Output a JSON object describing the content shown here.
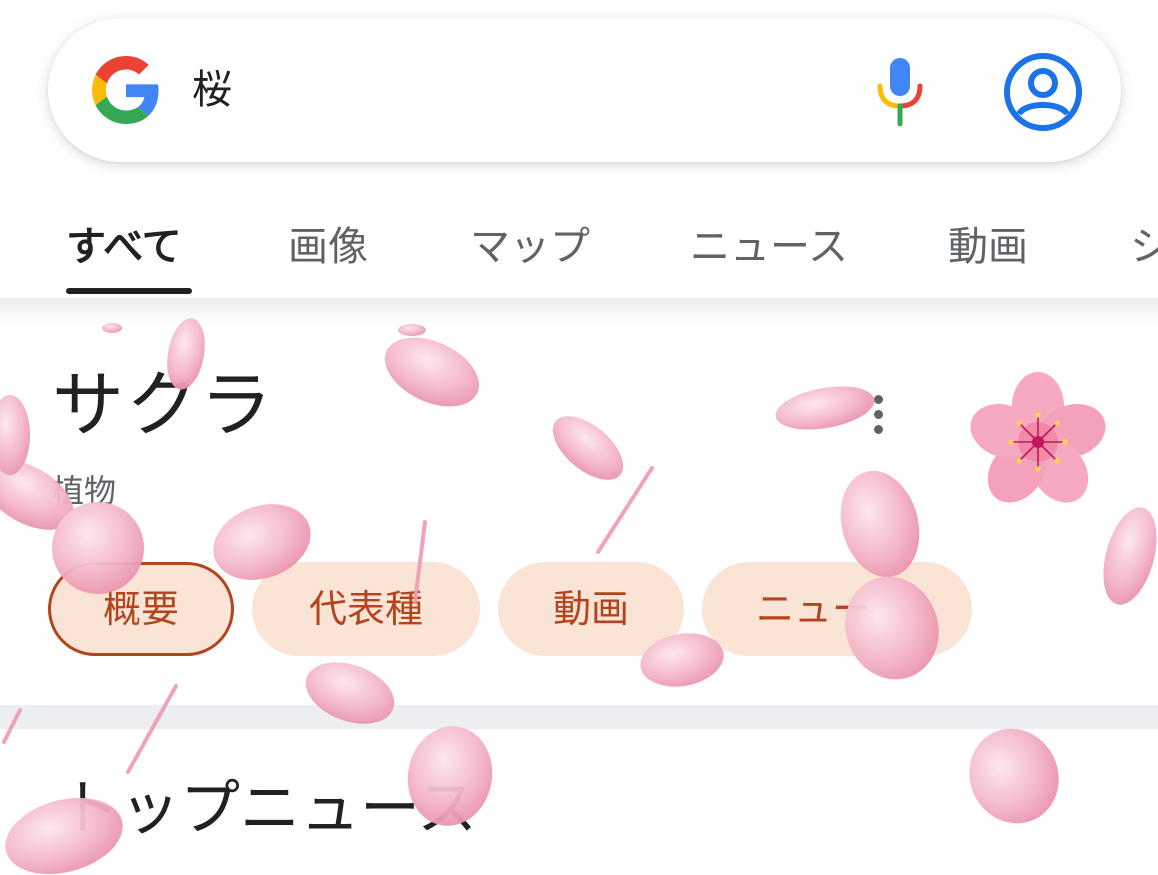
{
  "search": {
    "query": "桜"
  },
  "icons": {
    "logo": "google-g-logo",
    "mic": "microphone-icon",
    "account": "account-circle-icon",
    "more": "more-vert-icon",
    "entity_image": "sakura-blossom-icon"
  },
  "tabs": [
    {
      "label": "すべて",
      "active": true
    },
    {
      "label": "画像"
    },
    {
      "label": "マップ"
    },
    {
      "label": "ニュース"
    },
    {
      "label": "動画"
    },
    {
      "label": "シ"
    }
  ],
  "entity": {
    "title": "サクラ",
    "subtitle": "植物"
  },
  "chips": [
    {
      "label": "概要",
      "selected": true
    },
    {
      "label": "代表種"
    },
    {
      "label": "動画"
    },
    {
      "label": "ニュー"
    }
  ],
  "news": {
    "title": "トップニュース"
  },
  "colors": {
    "chip_bg": "#fae4d6",
    "chip_text": "#b3441e",
    "account_blue": "#1a73e8",
    "petal_pink": "#f2b3c6"
  }
}
